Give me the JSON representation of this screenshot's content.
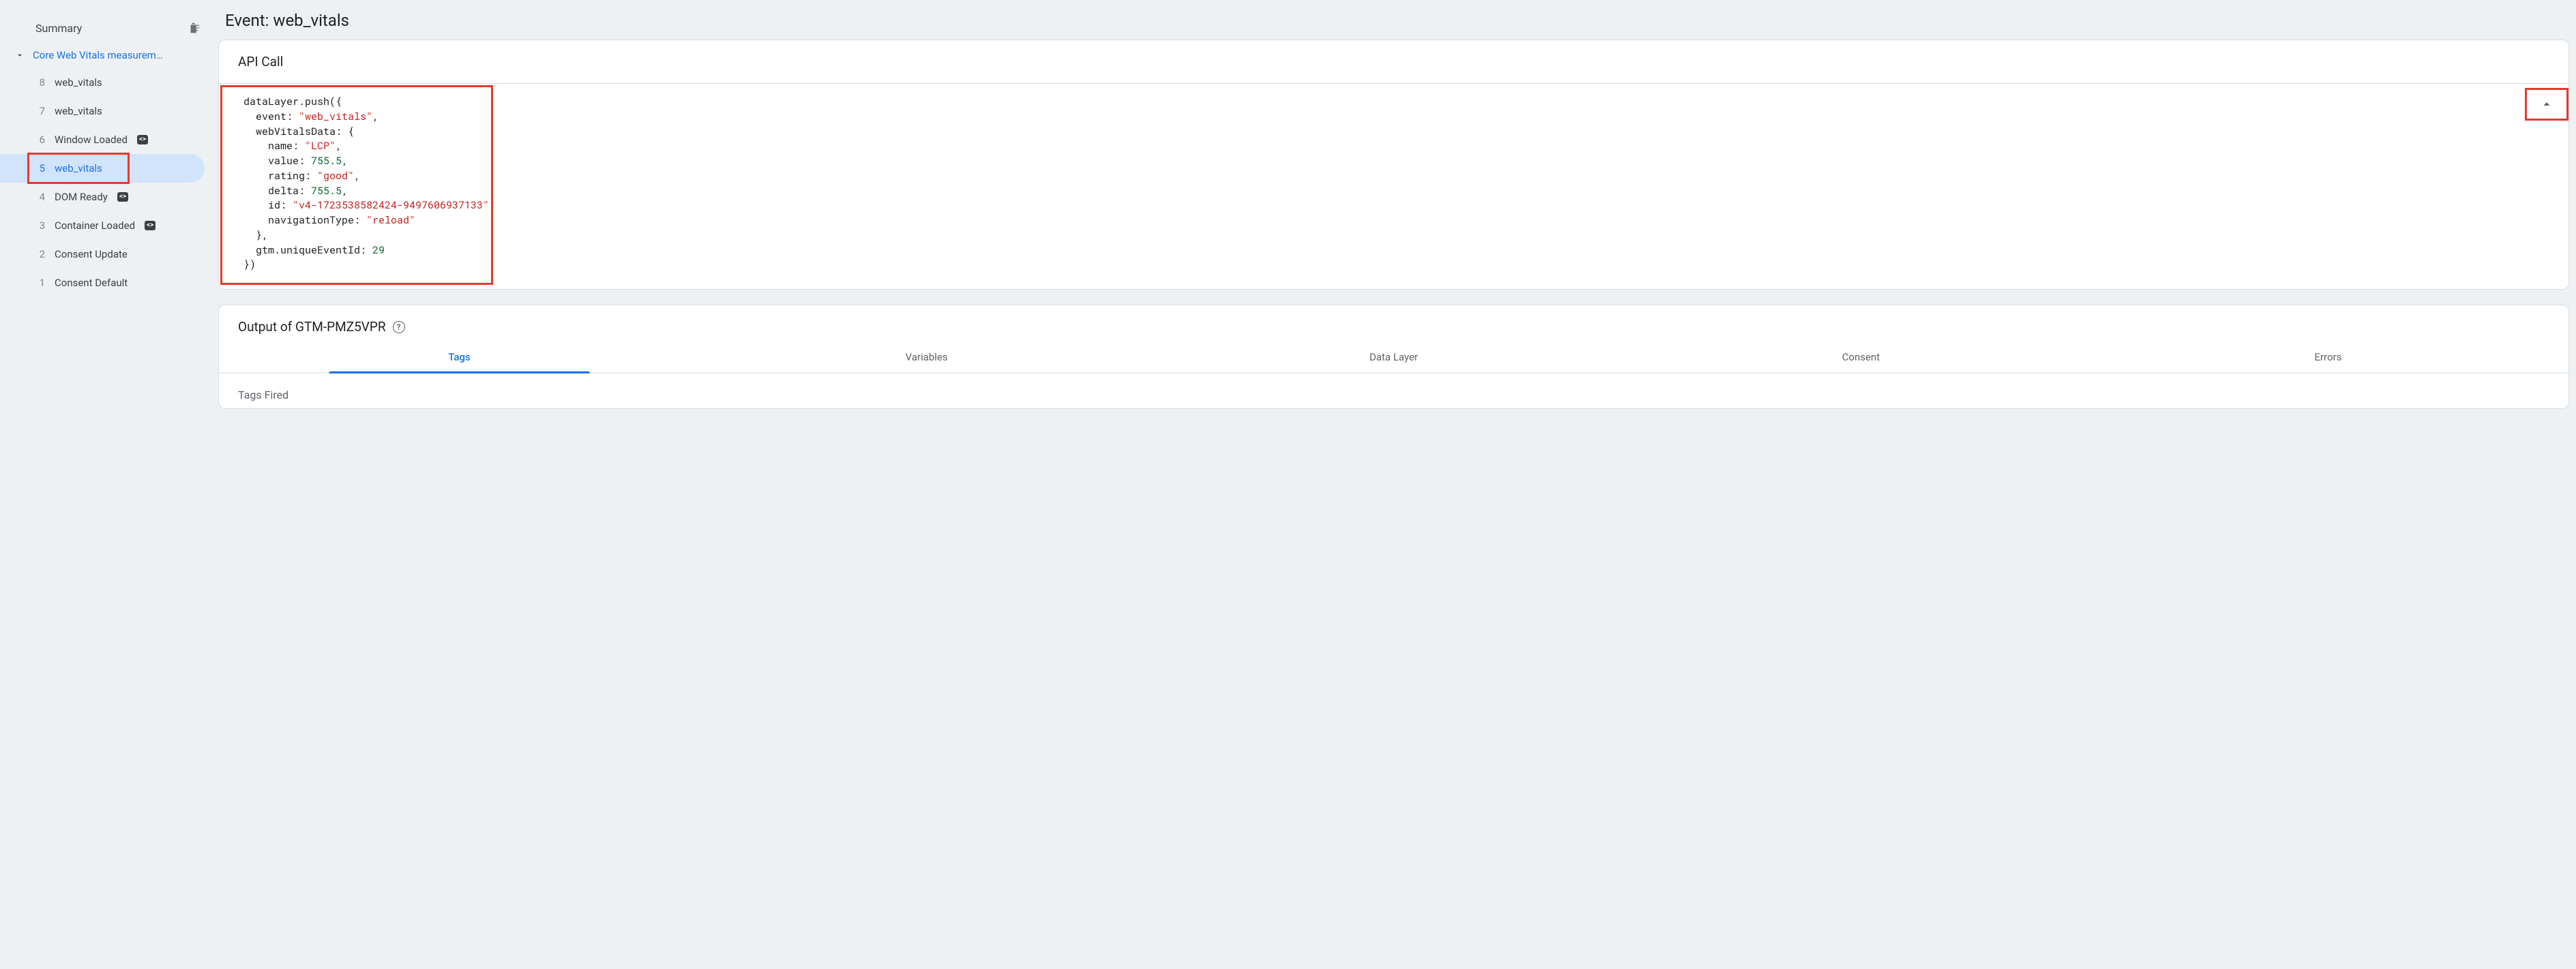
{
  "sidebar": {
    "summary_label": "Summary",
    "group_label": "Core Web Vitals measurem…",
    "events": [
      {
        "num": "8",
        "label": "web_vitals",
        "chip": null
      },
      {
        "num": "7",
        "label": "web_vitals",
        "chip": null
      },
      {
        "num": "6",
        "label": "Window Loaded",
        "chip": "<>"
      },
      {
        "num": "5",
        "label": "web_vitals",
        "chip": null,
        "active": true
      },
      {
        "num": "4",
        "label": "DOM Ready",
        "chip": "<>"
      },
      {
        "num": "3",
        "label": "Container Loaded",
        "chip": "<>"
      },
      {
        "num": "2",
        "label": "Consent Update",
        "chip": null
      },
      {
        "num": "1",
        "label": "Consent Default",
        "chip": null
      }
    ]
  },
  "header": {
    "title": "Event: web_vitals"
  },
  "api_call": {
    "title": "API Call",
    "code": {
      "fn": "dataLayer.push",
      "event": "web_vitals",
      "webVitalsData": {
        "name": "LCP",
        "value": 755.5,
        "rating": "good",
        "delta": 755.5,
        "id": "v4-1723538582424-9497606937133",
        "navigationType": "reload"
      },
      "uniqueEventId": 29
    }
  },
  "output": {
    "title_prefix": "Output of ",
    "container_id": "GTM-PMZ5VPR",
    "tabs": [
      "Tags",
      "Variables",
      "Data Layer",
      "Consent",
      "Errors"
    ],
    "active_tab": 0,
    "section_sub": "Tags Fired"
  }
}
